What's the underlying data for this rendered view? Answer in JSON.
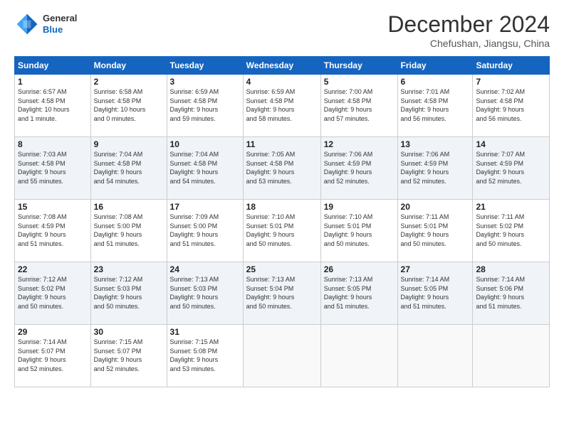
{
  "header": {
    "logo_general": "General",
    "logo_blue": "Blue",
    "month": "December 2024",
    "location": "Chefushan, Jiangsu, China"
  },
  "weekdays": [
    "Sunday",
    "Monday",
    "Tuesday",
    "Wednesday",
    "Thursday",
    "Friday",
    "Saturday"
  ],
  "weeks": [
    [
      {
        "day": "1",
        "info": "Sunrise: 6:57 AM\nSunset: 4:58 PM\nDaylight: 10 hours\nand 1 minute."
      },
      {
        "day": "2",
        "info": "Sunrise: 6:58 AM\nSunset: 4:58 PM\nDaylight: 10 hours\nand 0 minutes."
      },
      {
        "day": "3",
        "info": "Sunrise: 6:59 AM\nSunset: 4:58 PM\nDaylight: 9 hours\nand 59 minutes."
      },
      {
        "day": "4",
        "info": "Sunrise: 6:59 AM\nSunset: 4:58 PM\nDaylight: 9 hours\nand 58 minutes."
      },
      {
        "day": "5",
        "info": "Sunrise: 7:00 AM\nSunset: 4:58 PM\nDaylight: 9 hours\nand 57 minutes."
      },
      {
        "day": "6",
        "info": "Sunrise: 7:01 AM\nSunset: 4:58 PM\nDaylight: 9 hours\nand 56 minutes."
      },
      {
        "day": "7",
        "info": "Sunrise: 7:02 AM\nSunset: 4:58 PM\nDaylight: 9 hours\nand 56 minutes."
      }
    ],
    [
      {
        "day": "8",
        "info": "Sunrise: 7:03 AM\nSunset: 4:58 PM\nDaylight: 9 hours\nand 55 minutes."
      },
      {
        "day": "9",
        "info": "Sunrise: 7:04 AM\nSunset: 4:58 PM\nDaylight: 9 hours\nand 54 minutes."
      },
      {
        "day": "10",
        "info": "Sunrise: 7:04 AM\nSunset: 4:58 PM\nDaylight: 9 hours\nand 54 minutes."
      },
      {
        "day": "11",
        "info": "Sunrise: 7:05 AM\nSunset: 4:58 PM\nDaylight: 9 hours\nand 53 minutes."
      },
      {
        "day": "12",
        "info": "Sunrise: 7:06 AM\nSunset: 4:59 PM\nDaylight: 9 hours\nand 52 minutes."
      },
      {
        "day": "13",
        "info": "Sunrise: 7:06 AM\nSunset: 4:59 PM\nDaylight: 9 hours\nand 52 minutes."
      },
      {
        "day": "14",
        "info": "Sunrise: 7:07 AM\nSunset: 4:59 PM\nDaylight: 9 hours\nand 52 minutes."
      }
    ],
    [
      {
        "day": "15",
        "info": "Sunrise: 7:08 AM\nSunset: 4:59 PM\nDaylight: 9 hours\nand 51 minutes."
      },
      {
        "day": "16",
        "info": "Sunrise: 7:08 AM\nSunset: 5:00 PM\nDaylight: 9 hours\nand 51 minutes."
      },
      {
        "day": "17",
        "info": "Sunrise: 7:09 AM\nSunset: 5:00 PM\nDaylight: 9 hours\nand 51 minutes."
      },
      {
        "day": "18",
        "info": "Sunrise: 7:10 AM\nSunset: 5:01 PM\nDaylight: 9 hours\nand 50 minutes."
      },
      {
        "day": "19",
        "info": "Sunrise: 7:10 AM\nSunset: 5:01 PM\nDaylight: 9 hours\nand 50 minutes."
      },
      {
        "day": "20",
        "info": "Sunrise: 7:11 AM\nSunset: 5:01 PM\nDaylight: 9 hours\nand 50 minutes."
      },
      {
        "day": "21",
        "info": "Sunrise: 7:11 AM\nSunset: 5:02 PM\nDaylight: 9 hours\nand 50 minutes."
      }
    ],
    [
      {
        "day": "22",
        "info": "Sunrise: 7:12 AM\nSunset: 5:02 PM\nDaylight: 9 hours\nand 50 minutes."
      },
      {
        "day": "23",
        "info": "Sunrise: 7:12 AM\nSunset: 5:03 PM\nDaylight: 9 hours\nand 50 minutes."
      },
      {
        "day": "24",
        "info": "Sunrise: 7:13 AM\nSunset: 5:03 PM\nDaylight: 9 hours\nand 50 minutes."
      },
      {
        "day": "25",
        "info": "Sunrise: 7:13 AM\nSunset: 5:04 PM\nDaylight: 9 hours\nand 50 minutes."
      },
      {
        "day": "26",
        "info": "Sunrise: 7:13 AM\nSunset: 5:05 PM\nDaylight: 9 hours\nand 51 minutes."
      },
      {
        "day": "27",
        "info": "Sunrise: 7:14 AM\nSunset: 5:05 PM\nDaylight: 9 hours\nand 51 minutes."
      },
      {
        "day": "28",
        "info": "Sunrise: 7:14 AM\nSunset: 5:06 PM\nDaylight: 9 hours\nand 51 minutes."
      }
    ],
    [
      {
        "day": "29",
        "info": "Sunrise: 7:14 AM\nSunset: 5:07 PM\nDaylight: 9 hours\nand 52 minutes."
      },
      {
        "day": "30",
        "info": "Sunrise: 7:15 AM\nSunset: 5:07 PM\nDaylight: 9 hours\nand 52 minutes."
      },
      {
        "day": "31",
        "info": "Sunrise: 7:15 AM\nSunset: 5:08 PM\nDaylight: 9 hours\nand 53 minutes."
      },
      null,
      null,
      null,
      null
    ]
  ]
}
